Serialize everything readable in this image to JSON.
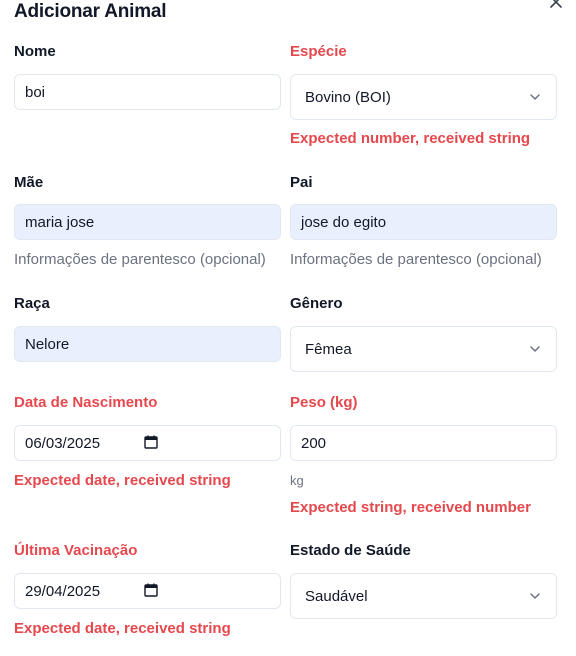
{
  "dialog": {
    "title": "Adicionar Animal"
  },
  "form": {
    "nome": {
      "label": "Nome",
      "value": "boi"
    },
    "especie": {
      "label": "Espécie",
      "value": "Bovino (BOI)",
      "error": "Expected number, received string"
    },
    "mae": {
      "label": "Mãe",
      "value": "maria jose",
      "hint": "Informações de parentesco (opcional)"
    },
    "pai": {
      "label": "Pai",
      "value": "jose do egito",
      "hint": "Informações de parentesco (opcional)"
    },
    "raca": {
      "label": "Raça",
      "value": "Nelore"
    },
    "genero": {
      "label": "Gênero",
      "value": "Fêmea"
    },
    "nascimento": {
      "label": "Data de Nascimento",
      "value": "06/03/2025",
      "error": "Expected date, received string"
    },
    "peso": {
      "label": "Peso (kg)",
      "value": "200",
      "unit": "kg",
      "error": "Expected string, received number"
    },
    "vacinacao": {
      "label": "Última Vacinação",
      "value": "29/04/2025",
      "error": "Expected date, received string"
    },
    "saude": {
      "label": "Estado de Saúde",
      "value": "Saudável"
    }
  },
  "colors": {
    "error": "#e5484d",
    "autofill": "#e8f0fe",
    "border": "#e2e8f0",
    "hint": "#6b7280"
  }
}
